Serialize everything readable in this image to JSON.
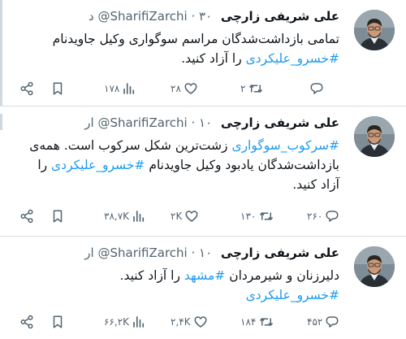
{
  "tweets": [
    {
      "name": "علی شریفی زارچی",
      "handle": "@SharifiZarchi",
      "time": "۳۰ د",
      "text_lines": [
        [
          "تمامی بازداشت‌شدگان مراسم سوگواری وکیل جاویدنام"
        ],
        [
          {
            "tag": "#خسرو_علیکردی"
          },
          " را آزاد کنید."
        ]
      ],
      "views": "۱۷۸",
      "likes": "۲۸",
      "retweets": "۲",
      "replies": ""
    },
    {
      "name": "علی شریفی زارچی",
      "handle": "@SharifiZarchi",
      "time": "۱۰ ار",
      "text_lines": [
        [
          {
            "tag": "#سرکوب_سوگواری"
          },
          " زشت‌ترین شکل سرکوب است. همه‌ی"
        ],
        [
          "بازداشت‌شدگان یادبود وکیل جاویدنام ",
          {
            "tag": "#خسرو_علیکردی"
          },
          " را"
        ],
        [
          "آزاد کنید."
        ]
      ],
      "views": "۳۸,۷K",
      "likes": "۲K",
      "retweets": "۱۳۰",
      "replies": "۲۶۰"
    },
    {
      "name": "علی شریفی زارچی",
      "handle": "@SharifiZarchi",
      "time": "۱۰ ار",
      "text_lines": [
        [
          "دلیرزنان و شیرمردان ",
          {
            "tag": "#مشهد"
          },
          " را آزاد کنید."
        ],
        [
          {
            "tag": "#خسرو_علیکردی"
          }
        ]
      ],
      "views": "۶۶,۲K",
      "likes": "۲,۴K",
      "retweets": "۱۸۴",
      "replies": "۴۵۲"
    }
  ],
  "colors": {
    "link": "#1d9bf0",
    "muted": "#536471",
    "divider": "#d7dde1"
  },
  "icons": [
    "share-icon",
    "bookmark-icon",
    "views-icon",
    "like-icon",
    "retweet-icon",
    "reply-icon"
  ]
}
